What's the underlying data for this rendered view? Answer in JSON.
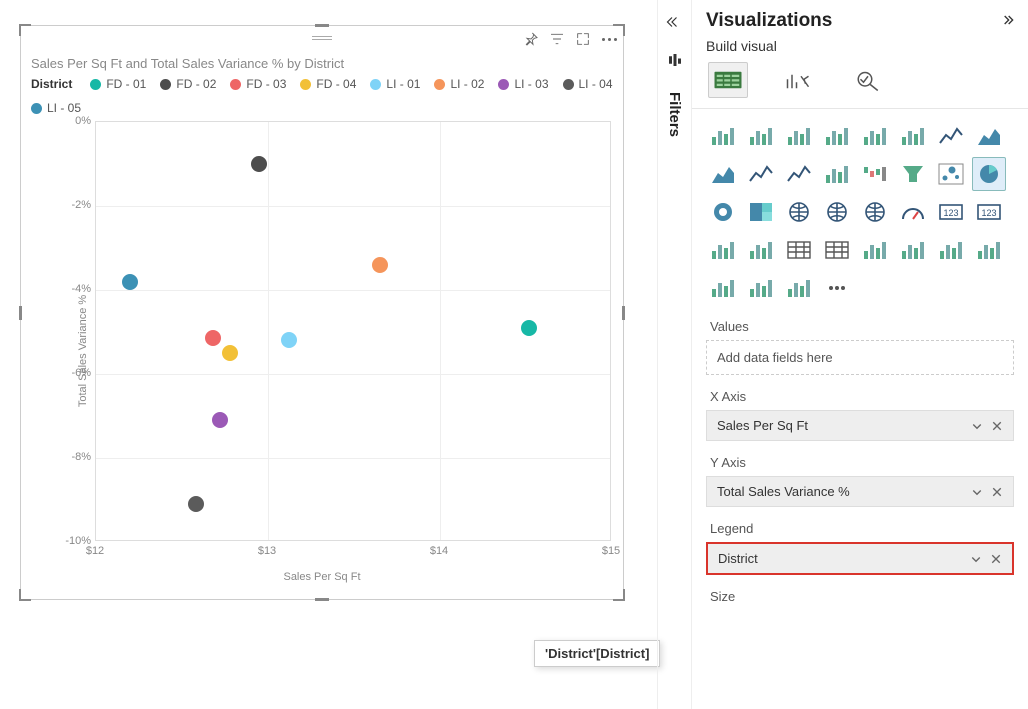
{
  "chart_data": {
    "type": "scatter",
    "title": "Sales Per Sq Ft and Total Sales Variance % by District",
    "xlabel": "Sales Per Sq Ft",
    "ylabel": "Total Sales Variance %",
    "xlim": [
      12,
      15
    ],
    "ylim": [
      -10,
      0
    ],
    "xticks": [
      12,
      13,
      14,
      15
    ],
    "yticks": [
      0,
      -2,
      -4,
      -6,
      -8,
      -10
    ],
    "xtick_labels": [
      "$12",
      "$13",
      "$14",
      "$15"
    ],
    "ytick_labels": [
      "0%",
      "-2%",
      "-4%",
      "-6%",
      "-8%",
      "-10%"
    ],
    "legend_title": "District",
    "series": [
      {
        "name": "FD - 01",
        "color": "#17B8A6",
        "x": 14.52,
        "y": -4.9
      },
      {
        "name": "FD - 02",
        "color": "#4D4D4D",
        "x": 12.95,
        "y": -1.0
      },
      {
        "name": "FD - 03",
        "color": "#EE6666",
        "x": 12.68,
        "y": -5.15
      },
      {
        "name": "FD - 04",
        "color": "#F2C037",
        "x": 12.78,
        "y": -5.5
      },
      {
        "name": "LI - 01",
        "color": "#7FD3F7",
        "x": 13.12,
        "y": -5.2
      },
      {
        "name": "LI - 02",
        "color": "#F5955B",
        "x": 13.65,
        "y": -3.4
      },
      {
        "name": "LI - 03",
        "color": "#9B59B6",
        "x": 12.72,
        "y": -7.1
      },
      {
        "name": "LI - 04",
        "color": "#5B5B5B",
        "x": 12.58,
        "y": -9.1
      },
      {
        "name": "LI - 05",
        "color": "#3C91B5",
        "x": 12.2,
        "y": -3.8
      }
    ]
  },
  "tooltip": "'District'[District]",
  "filters_label": "Filters",
  "viz_panel": {
    "title": "Visualizations",
    "subtitle": "Build visual",
    "tabs": [
      "Build",
      "Format",
      "Analytics"
    ],
    "fields": {
      "values": {
        "label": "Values",
        "placeholder": "Add data fields here"
      },
      "xaxis": {
        "label": "X Axis",
        "value": "Sales Per Sq Ft"
      },
      "yaxis": {
        "label": "Y Axis",
        "value": "Total Sales Variance %"
      },
      "legend": {
        "label": "Legend",
        "value": "District"
      },
      "size": {
        "label": "Size"
      }
    }
  },
  "viz_gallery": {
    "selected_index": 15,
    "items": [
      "stacked-bar",
      "clustered-bar",
      "stacked-bar-100",
      "clustered-column",
      "stacked-column",
      "stacked-column-100",
      "line",
      "area",
      "stacked-area",
      "line-clustered-column",
      "line-stacked-column",
      "ribbon",
      "waterfall",
      "funnel",
      "scatter",
      "pie",
      "donut",
      "treemap",
      "map",
      "filled-map",
      "azure-map",
      "gauge",
      "card",
      "multi-row-card",
      "kpi",
      "slicer",
      "table",
      "matrix",
      "r-visual",
      "decomposition-tree",
      "qa",
      "narrative",
      "paginated",
      "powerapps",
      "automate",
      "more"
    ]
  }
}
